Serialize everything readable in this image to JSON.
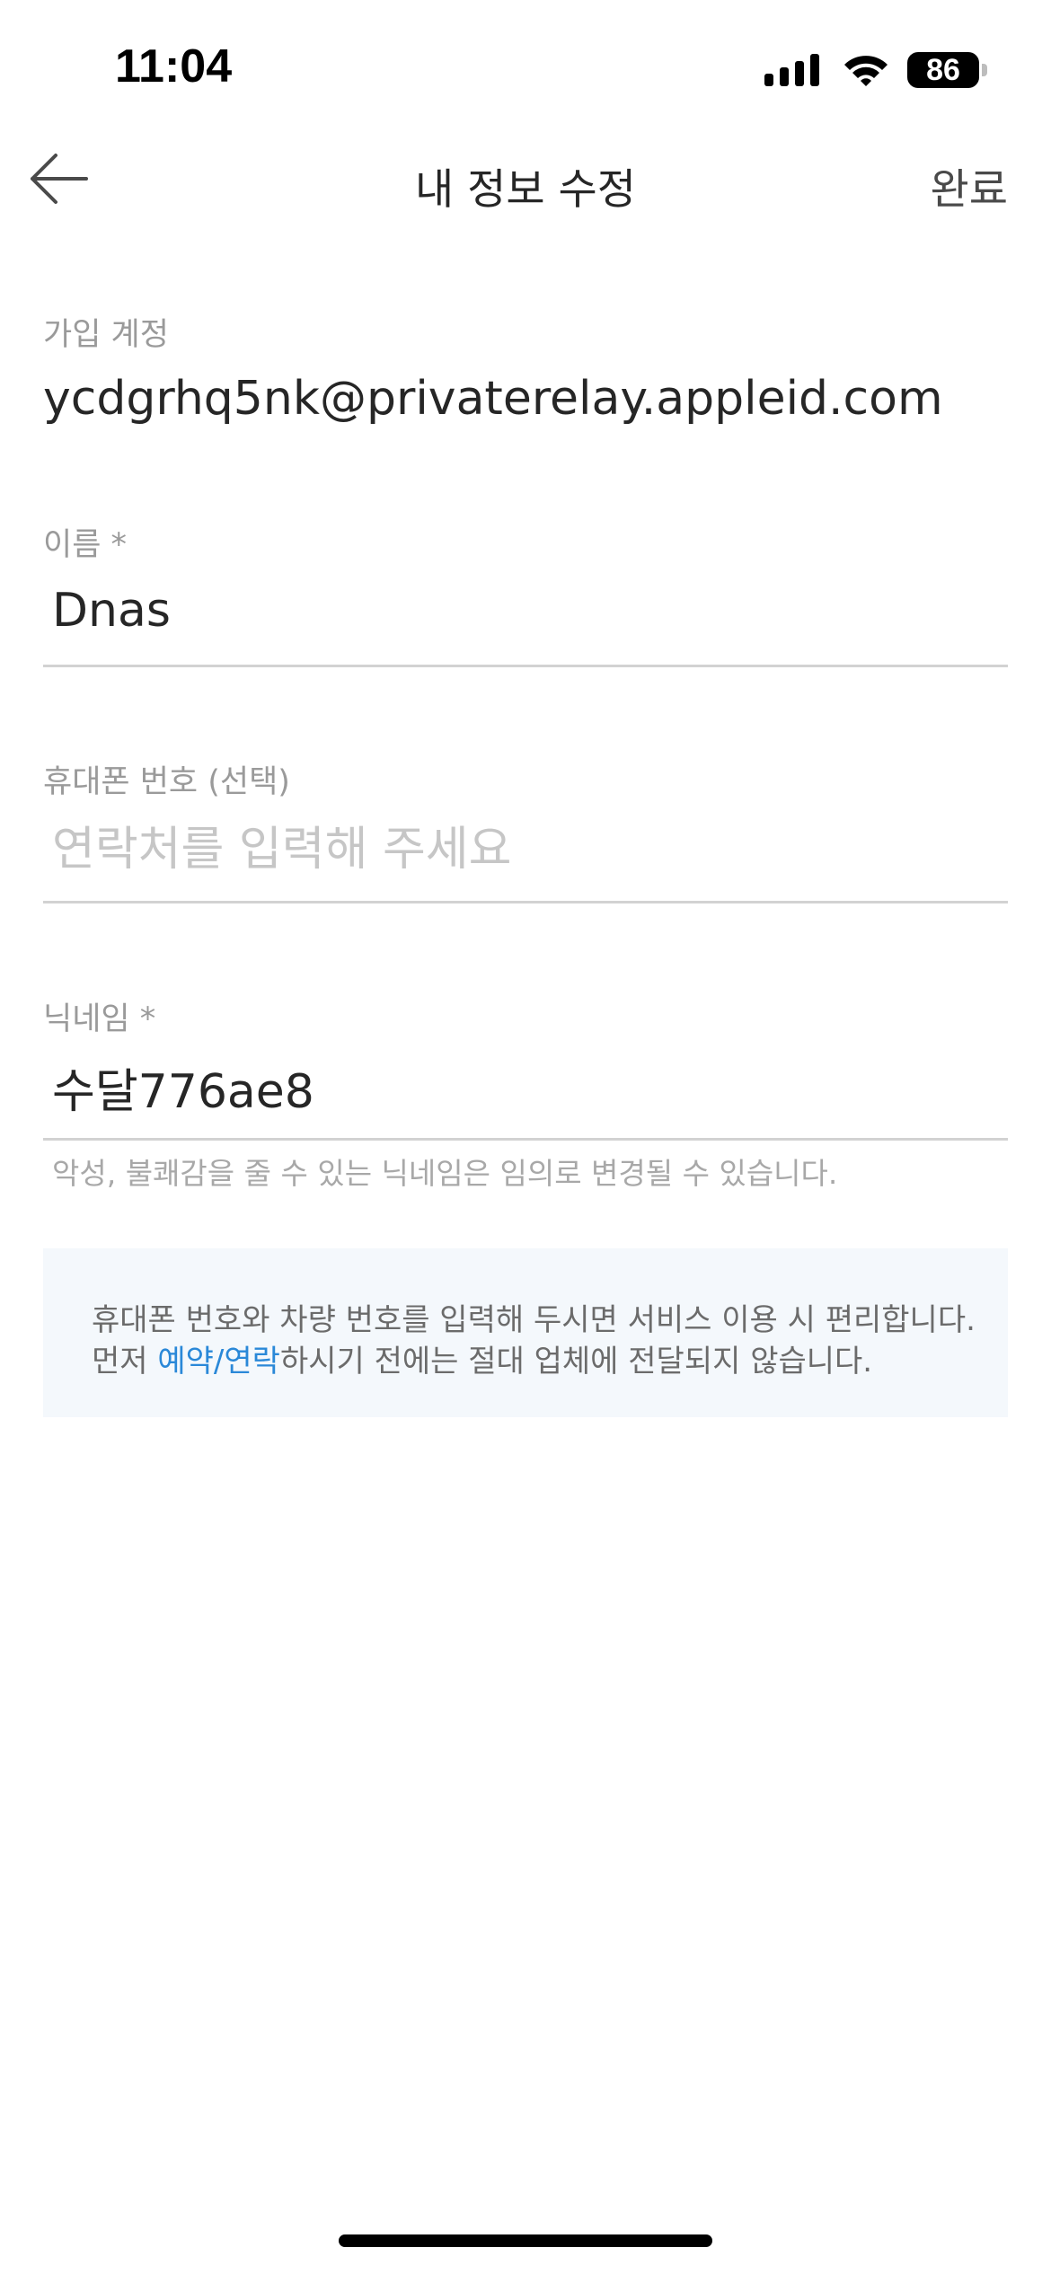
{
  "status_bar": {
    "time": "11:04",
    "battery": "86",
    "icons": [
      "cellular-signal-icon",
      "wifi-icon",
      "battery-icon"
    ]
  },
  "header": {
    "title": "내 정보 수정",
    "done_label": "완료",
    "back_icon": "arrow-left-icon"
  },
  "account": {
    "label": "가입 계정",
    "value": "ycdgrhq5nk@privaterelay.appleid.com"
  },
  "name": {
    "label": "이름 *",
    "value": "Dnas",
    "placeholder": ""
  },
  "phone": {
    "label": "휴대폰 번호 (선택)",
    "value": "",
    "placeholder": "연락처를 입력해 주세요"
  },
  "nickname": {
    "label": "닉네임 *",
    "value": "수달776ae8",
    "helper": "악성, 불쾌감을 줄 수 있는 닉네임은 임의로 변경될 수 있습니다."
  },
  "info": {
    "line1": "휴대폰 번호와 차량 번호를 입력해 두시면 서비스 이용 시 편리합니다.",
    "line2_prefix": "먼저 ",
    "line2_link": "예약/연락",
    "line2_suffix": "하시기 전에는 절대 업체에 전달되지 않습니다."
  },
  "colors": {
    "accent_link": "#2a88d8",
    "info_background": "#f4f8fc",
    "label_gray": "#9a9a9a",
    "divider": "#d2d2d2"
  }
}
